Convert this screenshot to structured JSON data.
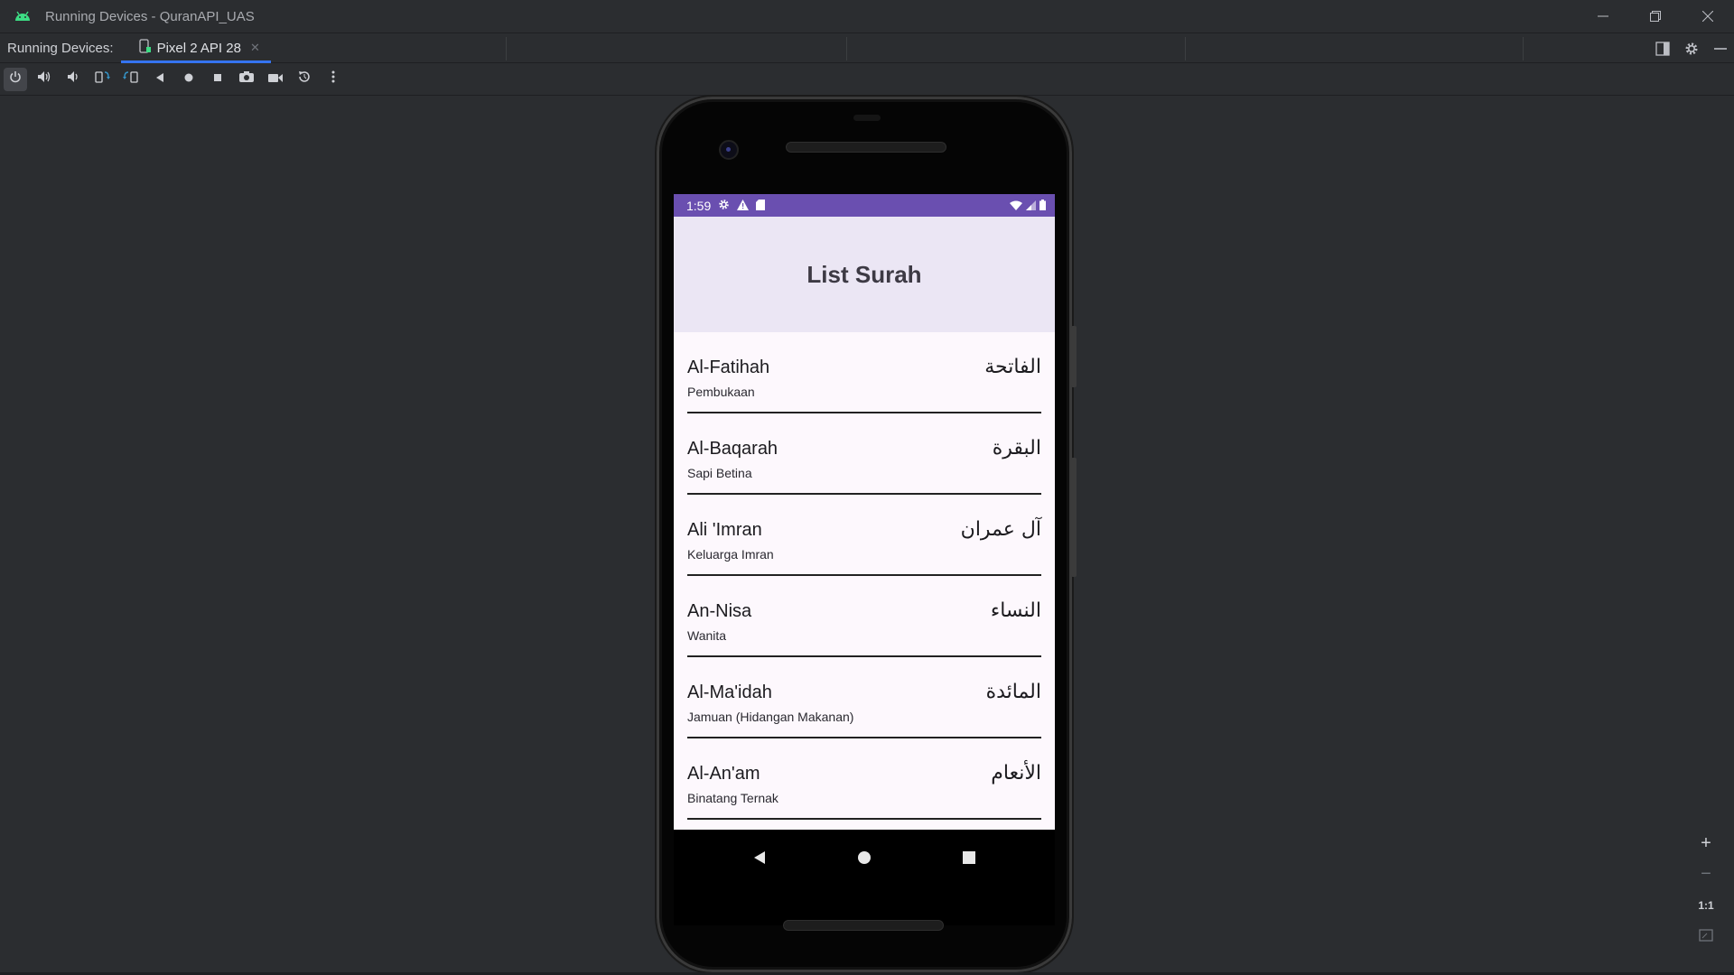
{
  "window": {
    "title": "Running Devices - QuranAPI_UAS",
    "icon": "android-icon"
  },
  "tabbar": {
    "label": "Running Devices:",
    "device_tab": "Pixel 2 API 28"
  },
  "toolbar": {
    "buttons": [
      "power-icon",
      "volume-up-icon",
      "volume-down-icon",
      "rotate-left-icon",
      "rotate-right-icon",
      "back-icon",
      "home-icon",
      "overview-icon",
      "screenshot-icon",
      "screen-record-icon",
      "reset-icon",
      "more-icon"
    ]
  },
  "device": {
    "status": {
      "time": "1:59",
      "icons": [
        "settings-icon",
        "warning-icon",
        "sd-card-icon",
        "wifi-icon",
        "signal-icon",
        "battery-icon"
      ]
    },
    "app": {
      "title": "List Surah",
      "surahs": [
        {
          "latin": "Al-Fatihah",
          "arabic": "الفاتحة",
          "meaning": "Pembukaan"
        },
        {
          "latin": "Al-Baqarah",
          "arabic": "البقرة",
          "meaning": "Sapi Betina"
        },
        {
          "latin": "Ali 'Imran",
          "arabic": "آل عمران",
          "meaning": "Keluarga Imran"
        },
        {
          "latin": "An-Nisa",
          "arabic": "النساء",
          "meaning": "Wanita"
        },
        {
          "latin": "Al-Ma'idah",
          "arabic": "المائدة",
          "meaning": "Jamuan (Hidangan Makanan)"
        },
        {
          "latin": "Al-An'am",
          "arabic": "الأنعام",
          "meaning": "Binatang Ternak"
        }
      ]
    }
  },
  "zoom": {
    "one_to_one": "1:1"
  },
  "colors": {
    "ide_bg": "#2b2d30",
    "status_bar": "#6a4fb0",
    "app_bar": "#ebe6f4",
    "accent": "#3574f0"
  }
}
